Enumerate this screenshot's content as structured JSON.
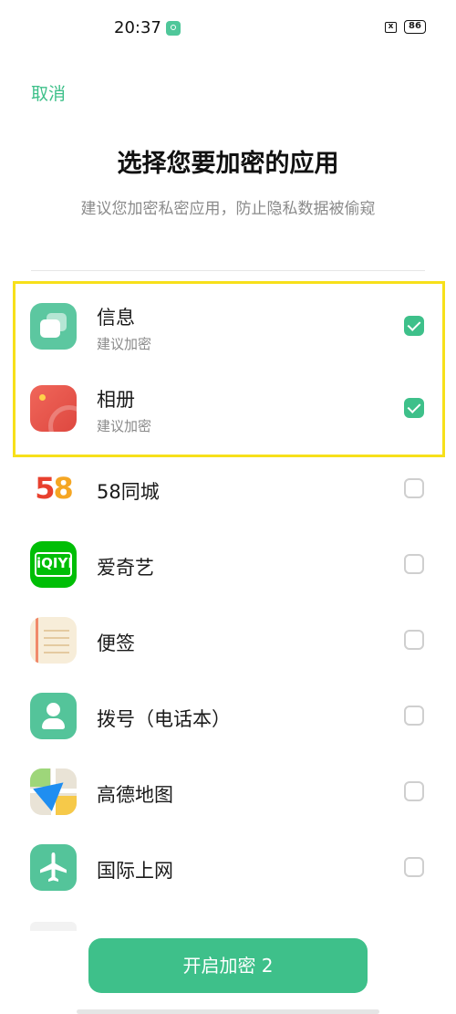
{
  "status_bar": {
    "time": "20:37",
    "battery": "86",
    "close_glyph": "x"
  },
  "header": {
    "cancel_label": "取消",
    "title": "选择您要加密的应用",
    "subtitle": "建议您加密私密应用，防止隐私数据被偷窥"
  },
  "apps": [
    {
      "name": "信息",
      "sub": "建议加密",
      "checked": true,
      "icon": "message-icon"
    },
    {
      "name": "相册",
      "sub": "建议加密",
      "checked": true,
      "icon": "gallery-icon"
    },
    {
      "name": "58同城",
      "checked": false,
      "icon": "58tongcheng-icon"
    },
    {
      "name": "爱奇艺",
      "checked": false,
      "icon": "iqiyi-icon"
    },
    {
      "name": "便签",
      "checked": false,
      "icon": "notes-icon"
    },
    {
      "name": "拨号（电话本）",
      "checked": false,
      "icon": "dialer-icon"
    },
    {
      "name": "高德地图",
      "checked": false,
      "icon": "amap-icon"
    },
    {
      "name": "国际上网",
      "checked": false,
      "icon": "global-internet-icon"
    }
  ],
  "icon_texts": {
    "digit_5": "5",
    "digit_8": "8",
    "iqiyi": "iQIYI"
  },
  "footer": {
    "start_button_label": "开启加密 2"
  },
  "colors": {
    "accent": "#3ec08a",
    "highlight": "#f7e01a"
  }
}
